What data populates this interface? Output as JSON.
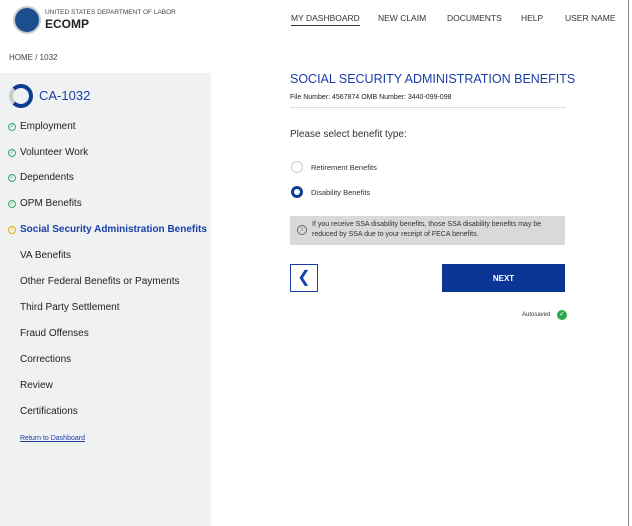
{
  "header": {
    "agency": "UNITED STATES DEPARTMENT OF LABOR",
    "app": "ECOMP",
    "nav": [
      "MY DASHBOARD",
      "NEW CLAIM",
      "DOCUMENTS",
      "HELP",
      "USER NAME"
    ]
  },
  "breadcrumb": "HOME  /  1032",
  "sidebar": {
    "form_id": "CA-1032",
    "items": [
      {
        "label": "Employment",
        "status": "complete"
      },
      {
        "label": "Volunteer Work",
        "status": "complete"
      },
      {
        "label": "Dependents",
        "status": "complete"
      },
      {
        "label": "OPM Benefits",
        "status": "complete"
      },
      {
        "label": "Social Security Administration Benefits",
        "status": "current"
      },
      {
        "label": "VA Benefits"
      },
      {
        "label": "Other Federal Benefits or Payments"
      },
      {
        "label": "Third Party Settlement"
      },
      {
        "label": "Fraud Offenses"
      },
      {
        "label": "Corrections"
      },
      {
        "label": "Review"
      },
      {
        "label": "Certifications"
      }
    ],
    "return_link": "Return to Dashboard"
  },
  "main": {
    "title": "SOCIAL SECURITY ADMINISTRATION BENEFITS",
    "meta": "File Number: 4567874   OMB Number: 3440-099-098",
    "question": "Please select benefit type:",
    "options": [
      {
        "label": "Retirement Benefits",
        "selected": false
      },
      {
        "label": "Disability Benefits",
        "selected": true
      }
    ],
    "info": "If you receive SSA disability benefits, those SSA disability benefits may be reduced by SSA due to your receipt of FECA benefits.",
    "back_icon": "chevron-left",
    "next_label": "NEXT",
    "autosaved": "Autosaved"
  },
  "colors": {
    "brand": "#0b3594",
    "link": "#1a3ea8",
    "complete": "#3aa66b",
    "current": "#e0b400"
  }
}
